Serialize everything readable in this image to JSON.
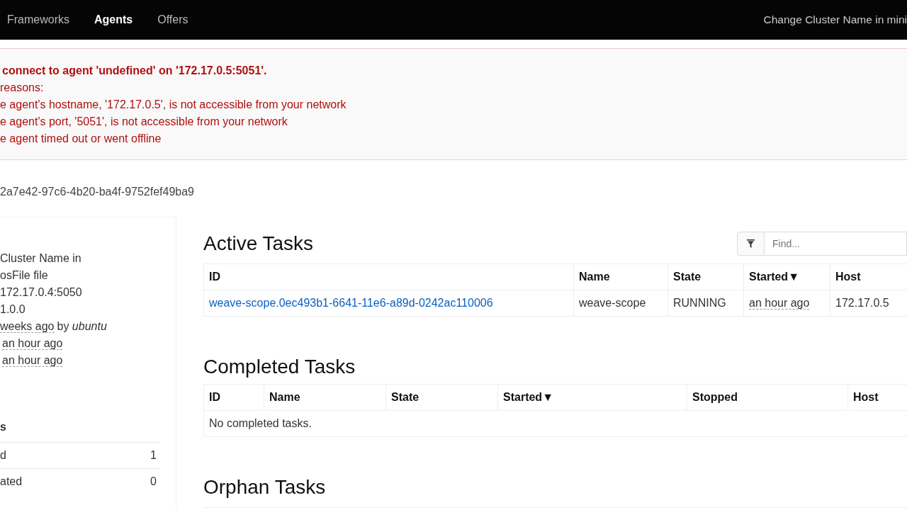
{
  "nav": {
    "items": [
      {
        "label": "Frameworks",
        "selected": false
      },
      {
        "label": "Agents",
        "selected": true
      },
      {
        "label": "Offers",
        "selected": false
      }
    ],
    "cluster_link": "Change Cluster Name in mini"
  },
  "alert": {
    "title": "connect to agent 'undefined' on '172.17.0.5:5051'.",
    "lines": [
      "reasons:",
      "e agent's hostname, '172.17.0.5', is not accessible from your network",
      "e agent's port, '5051', is not accessible from your network",
      "e agent timed out or went offline"
    ]
  },
  "agent_id": "2a7e42-97c6-4b20-ba4f-9752fef49ba9",
  "sidebar": {
    "info": [
      {
        "kind": "plain",
        "text": "Cluster Name in"
      },
      {
        "kind": "plain",
        "text": "osFile file"
      },
      {
        "kind": "plain",
        "text": "172.17.0.4:5050"
      },
      {
        "kind": "plain",
        "text": "1.0.0"
      },
      {
        "kind": "built",
        "time": "weeks ago",
        "by": "by *ubuntu*"
      },
      {
        "kind": "time",
        "time": "an hour ago"
      },
      {
        "kind": "time",
        "time": "an hour ago"
      }
    ],
    "tasks_heading": "s",
    "tasks": [
      {
        "label": "d",
        "count": "1"
      },
      {
        "label": "ated",
        "count": "0"
      }
    ]
  },
  "active_tasks": {
    "title": "Active Tasks",
    "filter": {
      "placeholder": "Find..."
    },
    "columns": [
      {
        "label": "ID"
      },
      {
        "label": "Name"
      },
      {
        "label": "State"
      },
      {
        "label": "Started",
        "arrow": "▼"
      },
      {
        "label": "Host"
      }
    ],
    "rows": [
      {
        "id": "weave-scope.0ec493b1-6641-11e6-a89d-0242ac110006",
        "name": "weave-scope",
        "state": "RUNNING",
        "started": "an hour ago",
        "host": "172.17.0.5"
      }
    ]
  },
  "completed_tasks": {
    "title": "Completed Tasks",
    "columns": [
      {
        "label": "ID"
      },
      {
        "label": "Name"
      },
      {
        "label": "State"
      },
      {
        "label": "Started",
        "arrow": "▼"
      },
      {
        "label": "Stopped"
      },
      {
        "label": "Host"
      }
    ],
    "empty_text": "No completed tasks."
  },
  "orphan_tasks": {
    "title": "Orphan Tasks"
  }
}
